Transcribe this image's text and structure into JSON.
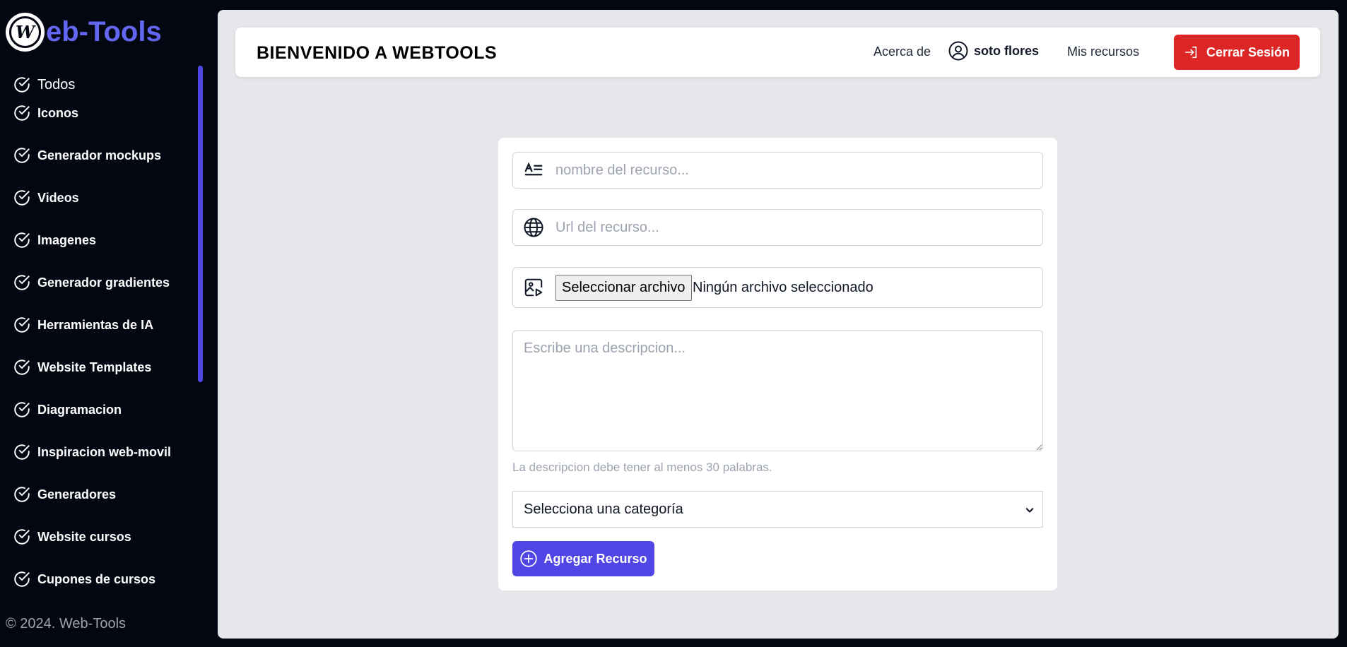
{
  "brand": {
    "logo_letter": "W",
    "name": "eb-Tools"
  },
  "sidebar": {
    "items": [
      {
        "label": "Todos"
      },
      {
        "label": "Iconos"
      },
      {
        "label": "Generador mockups"
      },
      {
        "label": "Videos"
      },
      {
        "label": "Imagenes"
      },
      {
        "label": "Generador gradientes"
      },
      {
        "label": "Herramientas de IA"
      },
      {
        "label": "Website Templates"
      },
      {
        "label": "Diagramacion"
      },
      {
        "label": "Inspiracion web-movil"
      },
      {
        "label": "Generadores"
      },
      {
        "label": "Website cursos"
      },
      {
        "label": "Cupones de cursos"
      }
    ],
    "footer": "© 2024. Web-Tools"
  },
  "header": {
    "title": "BIENVENIDO A WEBTOOLS",
    "about": "Acerca de",
    "user_name": "soto flores",
    "my_resources": "Mis recursos",
    "logout": "Cerrar Sesión"
  },
  "form": {
    "name_placeholder": "nombre del recurso...",
    "url_placeholder": "Url del recurso...",
    "file_button": "Seleccionar archivo",
    "file_status": "Ningún archivo seleccionado",
    "description_placeholder": "Escribe una descripcion...",
    "description_hint": "La descripcion debe tener al menos 30 palabras.",
    "category_value": "Selecciona una categoría",
    "submit": "Agregar Recurso"
  },
  "colors": {
    "accent": "#4f46e5",
    "brand": "#6366f1",
    "danger": "#dc2626",
    "sidebar_bg": "#030712",
    "main_bg": "#e5e7eb"
  },
  "icons": {
    "nav_item": "check-circle-icon",
    "name_field": "text-format-icon",
    "url_field": "globe-icon",
    "file_field": "image-video-icon",
    "user": "user-circle-icon",
    "logout": "logout-icon",
    "submit": "plus-circle-icon",
    "select": "chevron-down-icon"
  }
}
